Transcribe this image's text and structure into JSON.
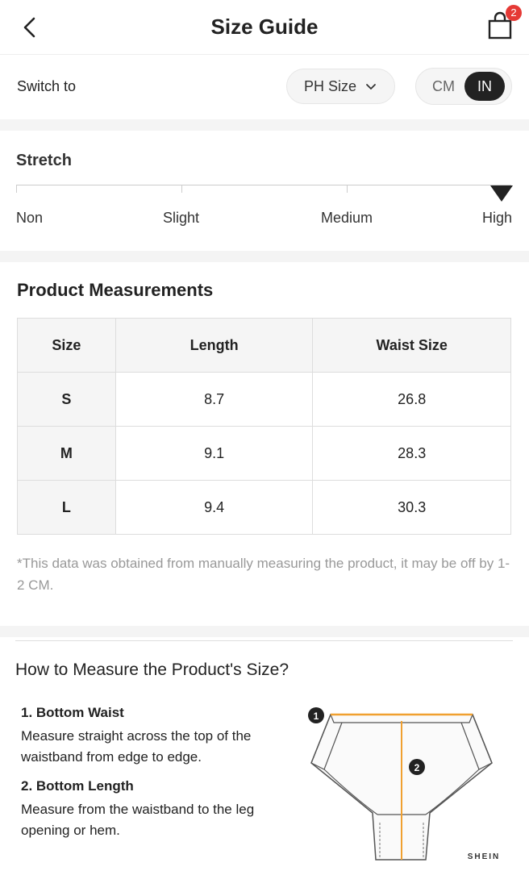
{
  "header": {
    "title": "Size Guide",
    "cart_count": "2",
    "back_icon": "chevron-left-icon",
    "cart_icon": "shopping-bag-icon"
  },
  "switch": {
    "label": "Switch to",
    "size_system": "PH Size",
    "units": [
      "CM",
      "IN"
    ],
    "selected_unit": "IN"
  },
  "stretch": {
    "title": "Stretch",
    "levels": [
      "Non",
      "Slight",
      "Medium",
      "High"
    ],
    "selected": "High"
  },
  "measurements": {
    "title": "Product Measurements",
    "headers": [
      "Size",
      "Length",
      "Waist Size"
    ],
    "rows": [
      [
        "S",
        "8.7",
        "26.8"
      ],
      [
        "M",
        "9.1",
        "28.3"
      ],
      [
        "L",
        "9.4",
        "30.3"
      ]
    ],
    "note": "*This data was obtained from manually measuring the product, it may be off by 1-2 CM."
  },
  "how_to": {
    "title": "How to Measure the Product's Size?",
    "steps": [
      {
        "title": "1. Bottom Waist",
        "desc": "Measure straight across the top of the waistband from edge to edge."
      },
      {
        "title": "2. Bottom Length",
        "desc": "Measure from the waistband to the leg opening or hem."
      }
    ],
    "diagram_markers": [
      "1",
      "2"
    ],
    "brand": "SHEIN"
  },
  "colors": {
    "accent": "#222222",
    "badge": "#e53935",
    "measure_line": "#f0a030",
    "muted_text": "#999999"
  }
}
